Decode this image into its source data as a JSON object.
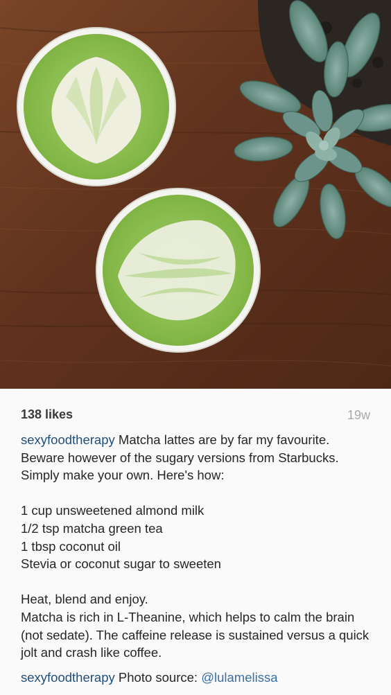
{
  "post": {
    "likes_text": "138 likes",
    "age_text": "19w"
  },
  "comments": [
    {
      "username": "sexyfoodtherapy",
      "text": "Matcha lattes are by far my favourite. Beware however of the sugary versions from Starbucks. Simply make your own. Here's how:\n\n1 cup unsweetened almond milk\n1/2 tsp matcha green tea\n1 tbsp coconut oil\nStevia or coconut sugar to sweeten\n\nHeat, blend and enjoy.\nMatcha is rich in L-Theanine, which helps to calm the brain (not sedate). The caffeine release is sustained versus a quick jolt and crash like coffee."
    },
    {
      "username": "sexyfoodtherapy",
      "text_prefix": "Photo source: ",
      "mention": "@lulamelissa"
    }
  ],
  "colors": {
    "username": "#1f4e79",
    "mention": "#3b6fa3",
    "timestamp": "#a8a8a8",
    "wood": "#6b3a22",
    "matcha": "#8cc152"
  }
}
